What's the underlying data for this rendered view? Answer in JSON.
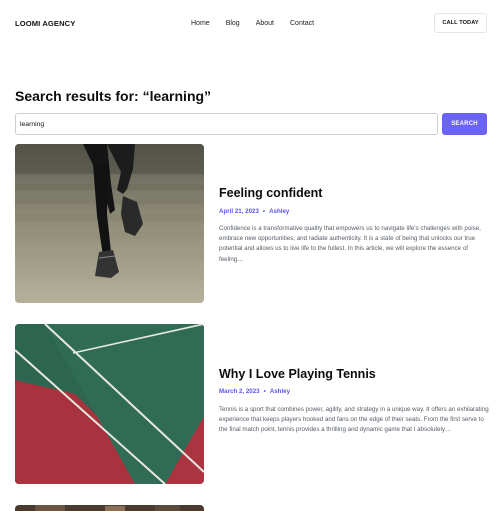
{
  "header": {
    "logo": "LOOMI AGENCY",
    "nav": [
      "Home",
      "Blog",
      "About",
      "Contact"
    ],
    "cta_label": "CALL TODAY"
  },
  "search": {
    "heading": "Search results for: “learning”",
    "value": "learning",
    "button_label": "SEARCH"
  },
  "posts": [
    {
      "title": "Feeling confident",
      "date": "April 21, 2023",
      "author": "Ashley",
      "excerpt": "Confidence is a transformative quality that empowers us to navigate life's challenges with poise, embrace new opportunities, and radiate authenticity. It is a state of being that unlocks our true potential and allows us to live life to the fullest. In this article, we will explore the essence of feeling…"
    },
    {
      "title": "Why I Love Playing Tennis",
      "date": "March 2, 2023",
      "author": "Ashley",
      "excerpt": "Tennis is a sport that combines power, agility, and strategy in a unique way. It offers an exhilarating experience that keeps players hooked and fans on the edge of their seats. From the first serve to the final match point, tennis provides a thrilling and dynamic game that I absolutely…"
    }
  ]
}
